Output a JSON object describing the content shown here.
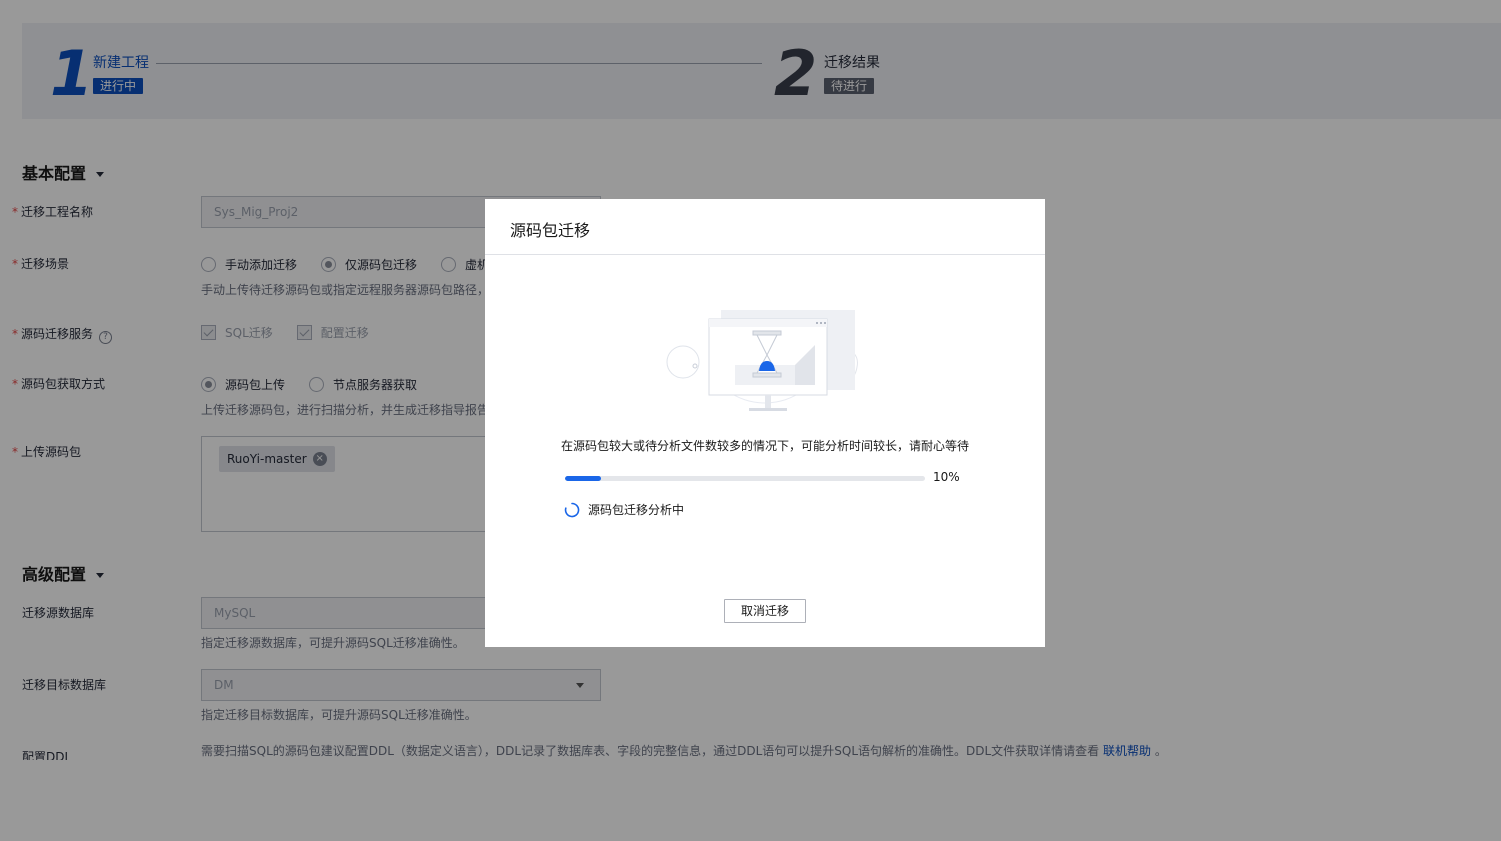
{
  "stepper": {
    "step1": {
      "number": "1",
      "title": "新建工程",
      "status": "进行中"
    },
    "step2": {
      "number": "2",
      "title": "迁移结果",
      "status": "待进行"
    }
  },
  "basic": {
    "title": "基本配置",
    "project_name": {
      "label": "迁移工程名称",
      "value": "Sys_Mig_Proj2"
    },
    "scene": {
      "label": "迁移场景",
      "options": [
        "手动添加迁移",
        "仅源码包迁移",
        "虚机"
      ],
      "selected": "仅源码包迁移",
      "hint": "手动上传待迁移源码包或指定远程服务器源码包路径，"
    },
    "service": {
      "label": "源码迁移服务",
      "options": [
        "SQL迁移",
        "配置迁移"
      ]
    },
    "fetch": {
      "label": "源码包获取方式",
      "options": [
        "源码包上传",
        "节点服务器获取"
      ],
      "selected": "源码包上传",
      "hint": "上传迁移源码包，进行扫描分析，并生成迁移指导报告"
    },
    "upload": {
      "label": "上传源码包",
      "tag": "RuoYi-master"
    }
  },
  "advanced": {
    "title": "高级配置",
    "source_db": {
      "label": "迁移源数据库",
      "value": "MySQL",
      "hint": "指定迁移源数据库，可提升源码SQL迁移准确性。"
    },
    "target_db": {
      "label": "迁移目标数据库",
      "value": "DM",
      "hint": "指定迁移目标数据库，可提升源码SQL迁移准确性。"
    },
    "ddl": {
      "label": "配置DDL",
      "hint": "需要扫描SQL的源码包建议配置DDL（数据定义语言），DDL记录了数据库表、字段的完整信息，通过DDL语句可以提升SQL语句解析的准确性。DDL文件获取详情请查看",
      "link": "联机帮助",
      "suffix": "。"
    }
  },
  "modal": {
    "title": "源码包迁移",
    "message": "在源码包较大或待分析文件数较多的情况下，可能分析时间较长，请耐心等待",
    "progress_value": 10,
    "progress_text": "10%",
    "status": "源码包迁移分析中",
    "cancel_label": "取消迁移"
  },
  "colors": {
    "primary": "#0c4fbf",
    "progress": "#1a66e8",
    "required": "#e54545"
  }
}
